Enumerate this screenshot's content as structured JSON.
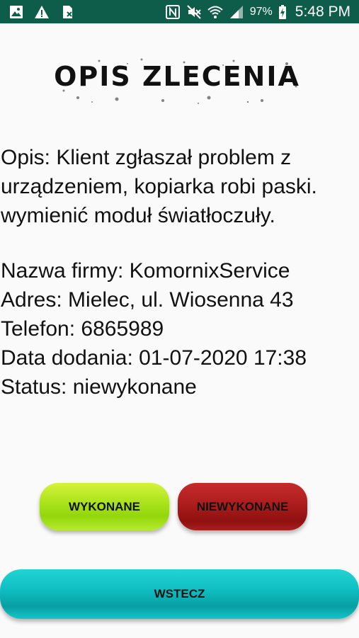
{
  "status_bar": {
    "battery": "97%",
    "time": "5:48 PM",
    "icons": [
      "image-icon",
      "warning-icon",
      "sim-icon",
      "nfc-icon",
      "mute-icon",
      "wifi-icon",
      "signal-icon",
      "battery-charging-icon"
    ]
  },
  "header": {
    "title": "OPIS ZLECENIA"
  },
  "order": {
    "description_lines": [
      "Opis: Klient zgłaszał problem z",
      "urządzeniem, kopiarka robi paski.",
      "wymienić moduł światłoczuły."
    ],
    "company": "Nazwa firmy: KomornixService",
    "address": "Adres: Mielec, ul. Wiosenna 43",
    "phone": "Telefon: 6865989",
    "date_added": "Data dodania: 01-07-2020 17:38",
    "status": "Status: niewykonane"
  },
  "actions": {
    "done_label": "WYKONANE",
    "not_done_label": "NIEWYKONANE",
    "back_label": "WSTECZ"
  },
  "colors": {
    "status_bar": "#0e5c4a",
    "done_button": "#a7e21a",
    "not_done_button": "#a91b1b",
    "back_button": "#0fbfc2"
  }
}
